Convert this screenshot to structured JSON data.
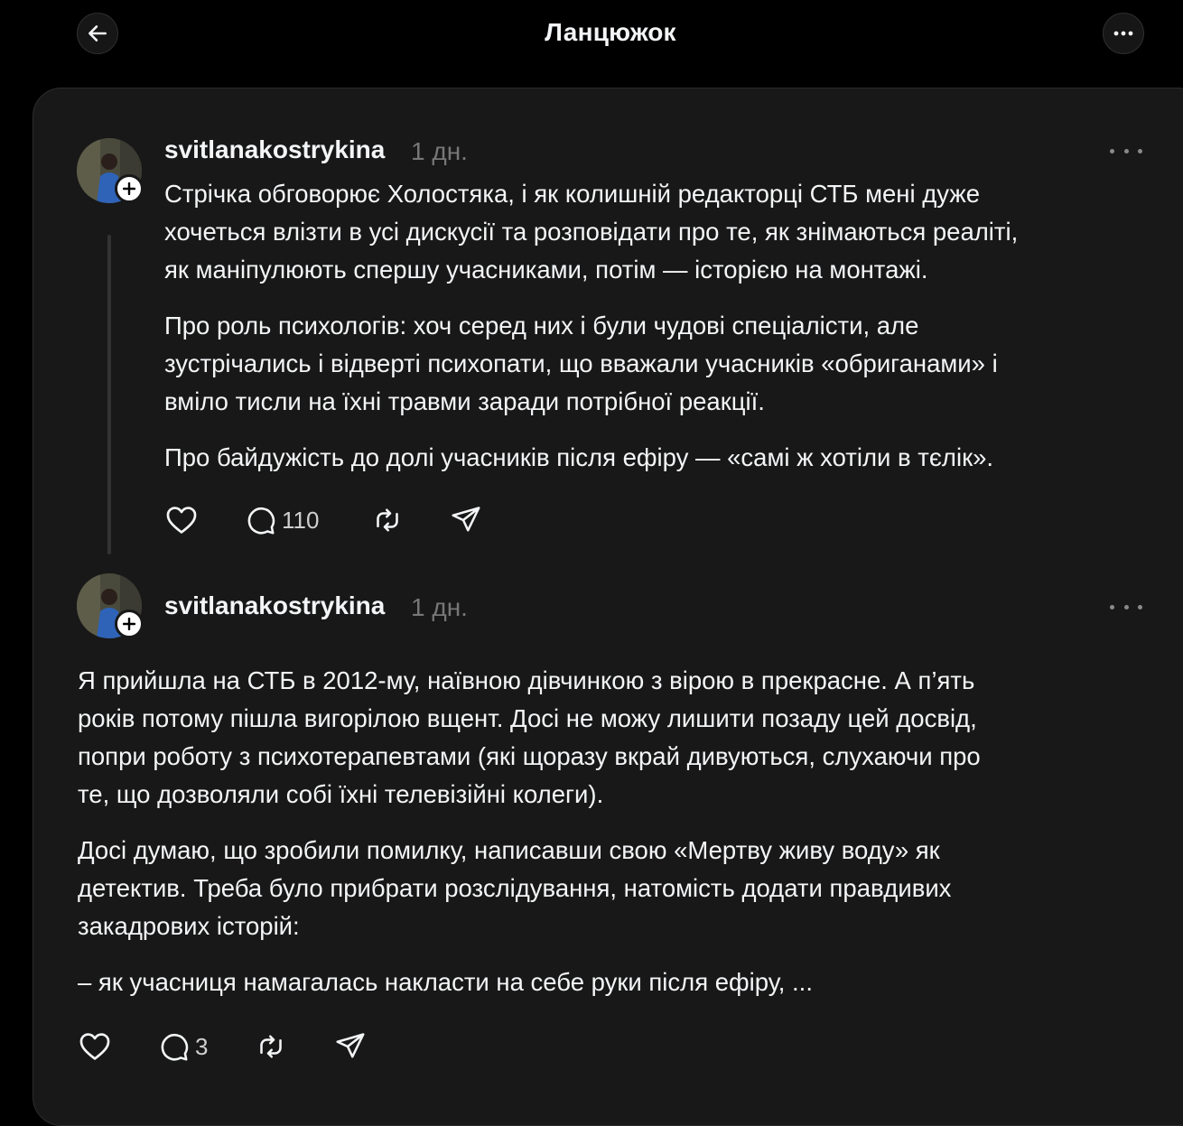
{
  "header": {
    "title": "Ланцюжок"
  },
  "posts": [
    {
      "username": "svitlanakostrykina",
      "time": "1 дн.",
      "paragraphs": [
        [
          "Стрічка обговорює Холостяка, і як колишній редакторці СТБ мені дуже",
          "хочеться влізти в усі дискусії та розповідати про те, як знімаються реаліті,",
          "як маніпулюють спершу учасниками, потім — історією на монтажі."
        ],
        [
          "Про роль психологів: хоч серед них і були чудові спеціалісти, але",
          "зустрічались і відверті психопати, що вважали учасників «обриганами» і",
          "вміло тисли на їхні травми заради потрібної реакції."
        ],
        [
          "Про байдужість до долі учасників після ефіру — «самі ж хотіли в тєлік»."
        ]
      ],
      "reply_count": "110"
    },
    {
      "username": "svitlanakostrykina",
      "time": "1 дн.",
      "paragraphs": [
        [
          "Я прийшла на СТБ в 2012-му, наївною дівчинкою з вірою в прекрасне. А п’ять",
          "років потому пішла вигорілою вщент. Досі не можу лишити позаду цей досвід,",
          "попри роботу з психотерапевтами (які щоразу вкрай дивуються, слухаючи про",
          "те, що дозволяли собі їхні телевізійні колеги)."
        ],
        [
          "Досі думаю, що зробили помилку, написавши свою «Мертву живу воду» як",
          "детектив. Треба було прибрати розслідування, натомість додати правдивих",
          "закадрових історій:"
        ],
        [
          "– як учасниця намагалась накласти на себе руки після ефіру, ..."
        ]
      ],
      "reply_count": "3"
    }
  ],
  "icons": {
    "back": "arrow-left-icon",
    "more": "more-horizontal-icon",
    "like": "heart-icon",
    "reply": "comment-icon",
    "repost": "repost-icon",
    "share": "send-icon",
    "follow": "plus-icon"
  },
  "colors": {
    "background": "#000000",
    "card": "#181818",
    "text": "#f3f5f7",
    "muted": "#777777"
  }
}
